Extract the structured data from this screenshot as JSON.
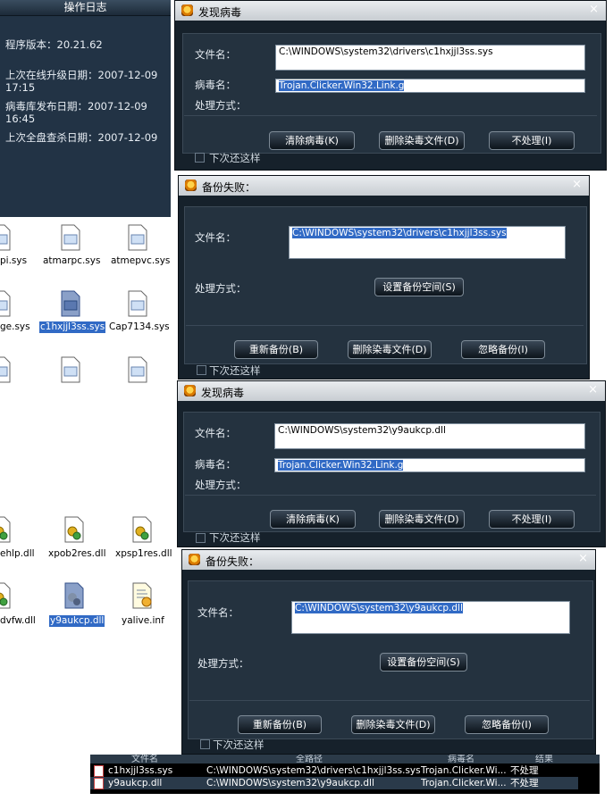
{
  "log": {
    "title": "操作日志",
    "version": "程序版本：20.21.62",
    "upgrade_date_label": "上次在线升级日期：2007-12-09",
    "upgrade_time": "17:15",
    "virusdb_label": "病毒库发布日期：2007-12-09",
    "virusdb_time": "16:45",
    "fullscan_label": "上次全盘查杀日期：2007-12-09"
  },
  "files": [
    {
      "label": "pi.sys"
    },
    {
      "label": "atmarpc.sys"
    },
    {
      "label": "atmepvc.sys"
    },
    {
      "label": "ge.sys"
    },
    {
      "label": "c1hxjjl3ss.sys"
    },
    {
      "label": "Cap7134.sys"
    },
    {
      "label": "ehlp.dll"
    },
    {
      "label": "xpob2res.dll"
    },
    {
      "label": "xpsp1res.dll"
    },
    {
      "label": "dvfw.dll"
    },
    {
      "label": "y9aukcp.dll"
    },
    {
      "label": "yalive.inf"
    }
  ],
  "dlg1": {
    "title": "发现病毒",
    "close": "×",
    "file_label": "文件名：",
    "file_value": "C:\\WINDOWS\\system32\\drivers\\c1hxjjl3ss.sys",
    "virus_label": "病毒名：",
    "virus_value": "Trojan.Clicker.Win32.Link.g",
    "action_label": "处理方式：",
    "btn_clean": "清除病毒(K)",
    "btn_delete": "删除染毒文件(D)",
    "btn_ignore": "不处理(I)",
    "checkbox": "下次还这样"
  },
  "dlg2": {
    "title": "备份失败：",
    "close": "×",
    "file_label": "文件名：",
    "file_value": "C:\\WINDOWS\\system32\\drivers\\c1hxjjl3ss.sys",
    "action_label": "处理方式：",
    "btn_space": "设置备份空间(S)",
    "btn_retry": "重新备份(B)",
    "btn_delete": "删除染毒文件(D)",
    "btn_skip": "忽略备份(I)",
    "checkbox": "下次还这样"
  },
  "dlg3": {
    "title": "发现病毒",
    "close": "×",
    "file_label": "文件名：",
    "file_value": "C:\\WINDOWS\\system32\\y9aukcp.dll",
    "virus_label": "病毒名：",
    "virus_value": "Trojan.Clicker.Win32.Link.g",
    "action_label": "处理方式：",
    "btn_clean": "清除病毒(K)",
    "btn_delete": "删除染毒文件(D)",
    "btn_ignore": "不处理(I)",
    "checkbox": "下次还这样"
  },
  "dlg4": {
    "title": "备份失败：",
    "close": "×",
    "file_label": "文件名：",
    "file_value": "C:\\WINDOWS\\system32\\y9aukcp.dll",
    "action_label": "处理方式：",
    "btn_space": "设置备份空间(S)",
    "btn_retry": "重新备份(B)",
    "btn_delete": "删除染毒文件(D)",
    "btn_skip": "忽略备份(I)",
    "checkbox": "下次还这样"
  },
  "table": {
    "headers": [
      "文件名",
      "全路径",
      "病毒名",
      "结果"
    ],
    "rows": [
      {
        "name": "c1hxjjl3ss.sys",
        "path": "C:\\WINDOWS\\system32\\drivers\\c1hxjjl3ss.sys",
        "virus": "Trojan.Clicker.Wi...",
        "result": "不处理"
      },
      {
        "name": "y9aukcp.dll",
        "path": "C:\\WINDOWS\\system32\\y9aukcp.dll",
        "virus": "Trojan.Clicker.Wi...",
        "result": "不处理"
      }
    ]
  },
  "colors": {
    "dialog_bg": "#16212b",
    "panel_bg": "#24323f",
    "selection": "#316ac5"
  }
}
